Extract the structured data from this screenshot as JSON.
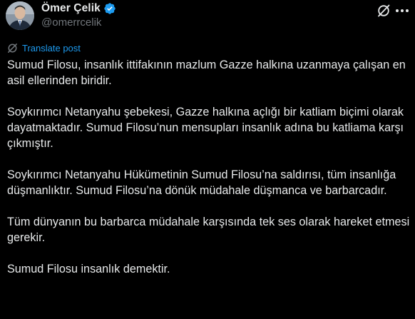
{
  "author": {
    "display_name": "Ömer Çelik",
    "handle": "@omerrcelik",
    "verified": true
  },
  "icons": {
    "avatar": "profile-photo",
    "verified": "verified-badge-icon",
    "grok": "grok-icon",
    "more": "more-options-icon",
    "translate": "translate-icon"
  },
  "colors": {
    "background": "#000000",
    "text": "#e7e9ea",
    "secondary_text": "#71767b",
    "accent": "#1d9bf0"
  },
  "translate": {
    "label": "Translate post"
  },
  "post": {
    "paragraphs": [
      "Sumud Filosu, insanlık ittifakının mazlum Gazze halkına uzanmaya çalışan en asil ellerinden biridir.",
      "Soykırımcı Netanyahu şebekesi, Gazze halkına açlığı bir katliam biçimi olarak dayatmaktadır. Sumud Filosu’nun mensupları insanlık adına bu katliama karşı çıkmıştır.",
      "Soykırımcı Netanyahu Hükümetinin Sumud Filosu’na saldırısı, tüm insanlığa düşmanlıktır. Sumud Filosu’na dönük müdahale düşmanca ve barbarcadır.",
      "Tüm dünyanın bu barbarca müdahale karşısında tek ses olarak hareket etmesi gerekir.",
      "Sumud Filosu insanlık demektir."
    ]
  }
}
